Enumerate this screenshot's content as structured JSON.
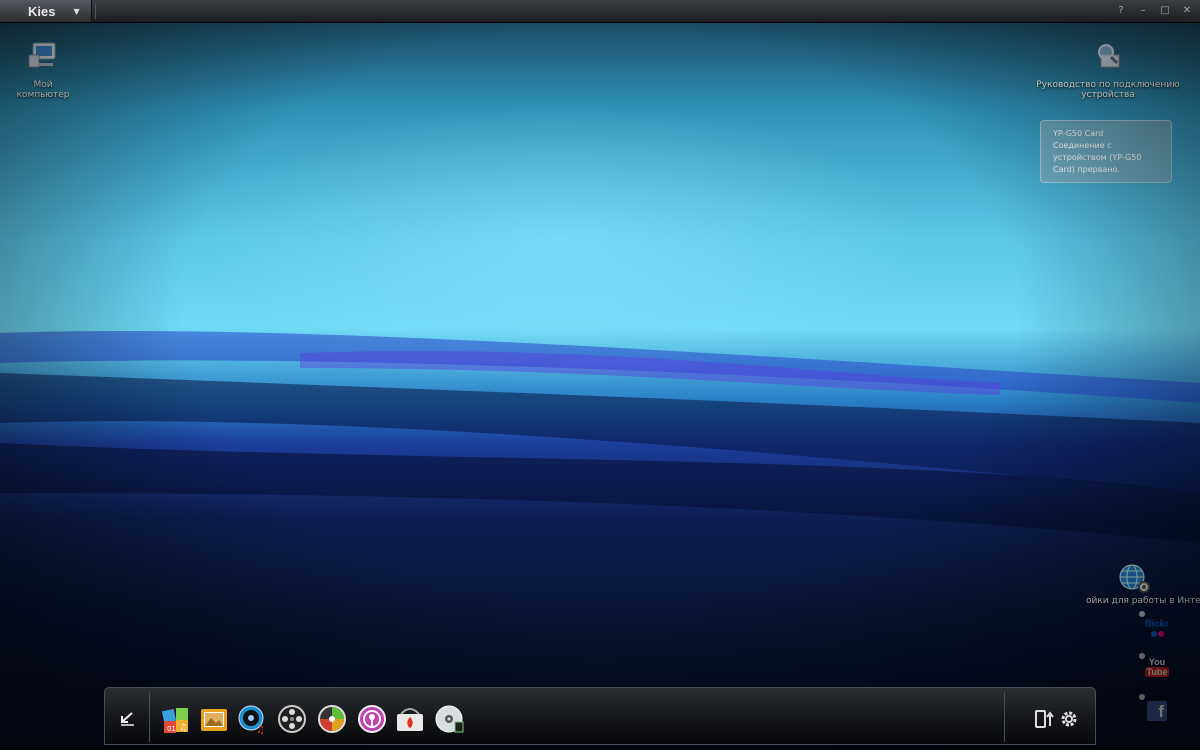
{
  "window": {
    "app_name": "Kies",
    "controls": [
      "?",
      "–",
      "□",
      "✕"
    ]
  },
  "desktop": {
    "my_computer_label": "Мой компьютер",
    "connection_guide_label": "Руководство по подключению устройства",
    "internet_settings_label": "ойки для работы в Инте"
  },
  "notification": {
    "title": "YP-G50 Card",
    "line1": "Соединение с",
    "line2": "устройством (YP-G50",
    "line3": "Card) прервано."
  },
  "social": {
    "flickr_text": "flickr",
    "youtube_text_1": "You",
    "youtube_text_2": "Tube",
    "facebook_text": "f"
  },
  "dock": {
    "items": [
      "apps-icon",
      "photo-folder-icon",
      "music-icon",
      "video-reel-icon",
      "media-icon",
      "podcast-icon",
      "store-icon",
      "disc-icon"
    ]
  },
  "colors": {
    "accent": "#2f93b9",
    "dock_bg": "#121417"
  }
}
